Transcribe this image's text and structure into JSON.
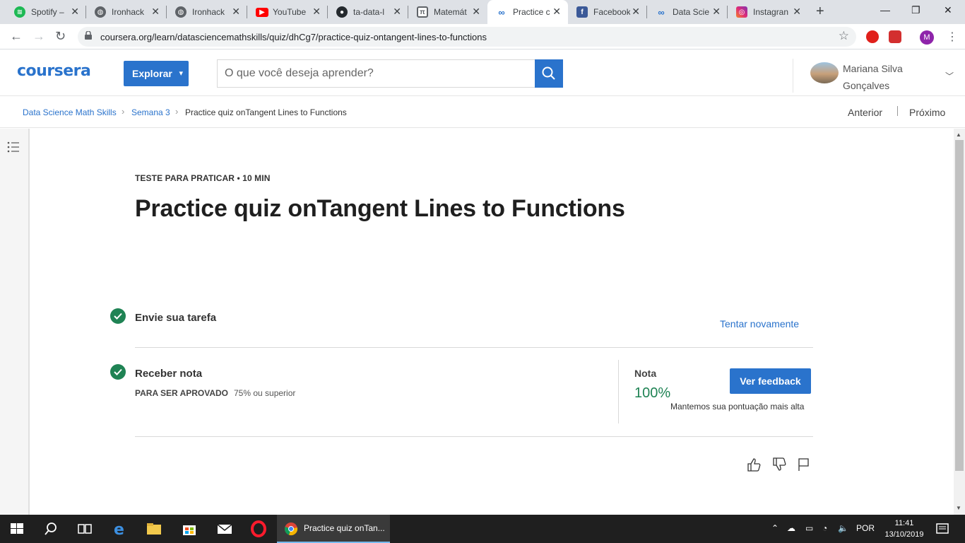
{
  "browser": {
    "tabs": [
      {
        "label": "Spotify –",
        "icon": "spotify-icon",
        "color": "#1db954"
      },
      {
        "label": "Ironhack",
        "icon": "globe-icon",
        "color": "#5f6368"
      },
      {
        "label": "Ironhack",
        "icon": "globe-icon",
        "color": "#5f6368"
      },
      {
        "label": "YouTube",
        "icon": "youtube-icon",
        "color": "#ff0000"
      },
      {
        "label": "ta-data-l",
        "icon": "github-icon",
        "color": "#24292e"
      },
      {
        "label": "Matemát",
        "icon": "doc-icon",
        "color": "#5f6368"
      },
      {
        "label": "Practice c",
        "icon": "coursera-icon",
        "color": "#2a73cc"
      },
      {
        "label": "Facebook",
        "icon": "facebook-icon",
        "color": "#3b5998"
      },
      {
        "label": "Data Scie",
        "icon": "coursera-icon",
        "color": "#2a73cc"
      },
      {
        "label": "Instagran",
        "icon": "instagram-icon",
        "color": "#c13584"
      }
    ],
    "url": "coursera.org/learn/datasciencemathskills/quiz/dhCg7/practice-quiz-ontangent-lines-to-functions",
    "profile_initial": "M"
  },
  "header": {
    "logo": "coursera",
    "explore_label": "Explorar",
    "search_placeholder": "O que você deseja aprender?",
    "user_first": "Mariana Silva",
    "user_last": "Gonçalves"
  },
  "breadcrumb": {
    "course": "Data Science Math Skills",
    "week": "Semana 3",
    "current": "Practice quiz onTangent Lines to Functions",
    "prev": "Anterior",
    "next": "Próximo"
  },
  "quiz": {
    "eyebrow": "TESTE PARA PRATICAR • 10 MIN",
    "title": "Practice quiz onTangent Lines to Functions",
    "step1_title": "Envie sua tarefa",
    "retry_label": "Tentar novamente",
    "step2_title": "Receber nota",
    "pass_label": "PARA SER APROVADO",
    "pass_value": "75% ou superior",
    "grade_label": "Nota",
    "grade_value": "100%",
    "feedback_label": "Ver feedback",
    "grade_note": "Mantemos sua pontuação mais alta"
  },
  "taskbar": {
    "active_app": "Practice quiz onTan...",
    "lang": "POR",
    "time": "11:41",
    "date": "13/10/2019"
  },
  "colors": {
    "brand": "#2a73cc",
    "success": "#1f8354"
  }
}
